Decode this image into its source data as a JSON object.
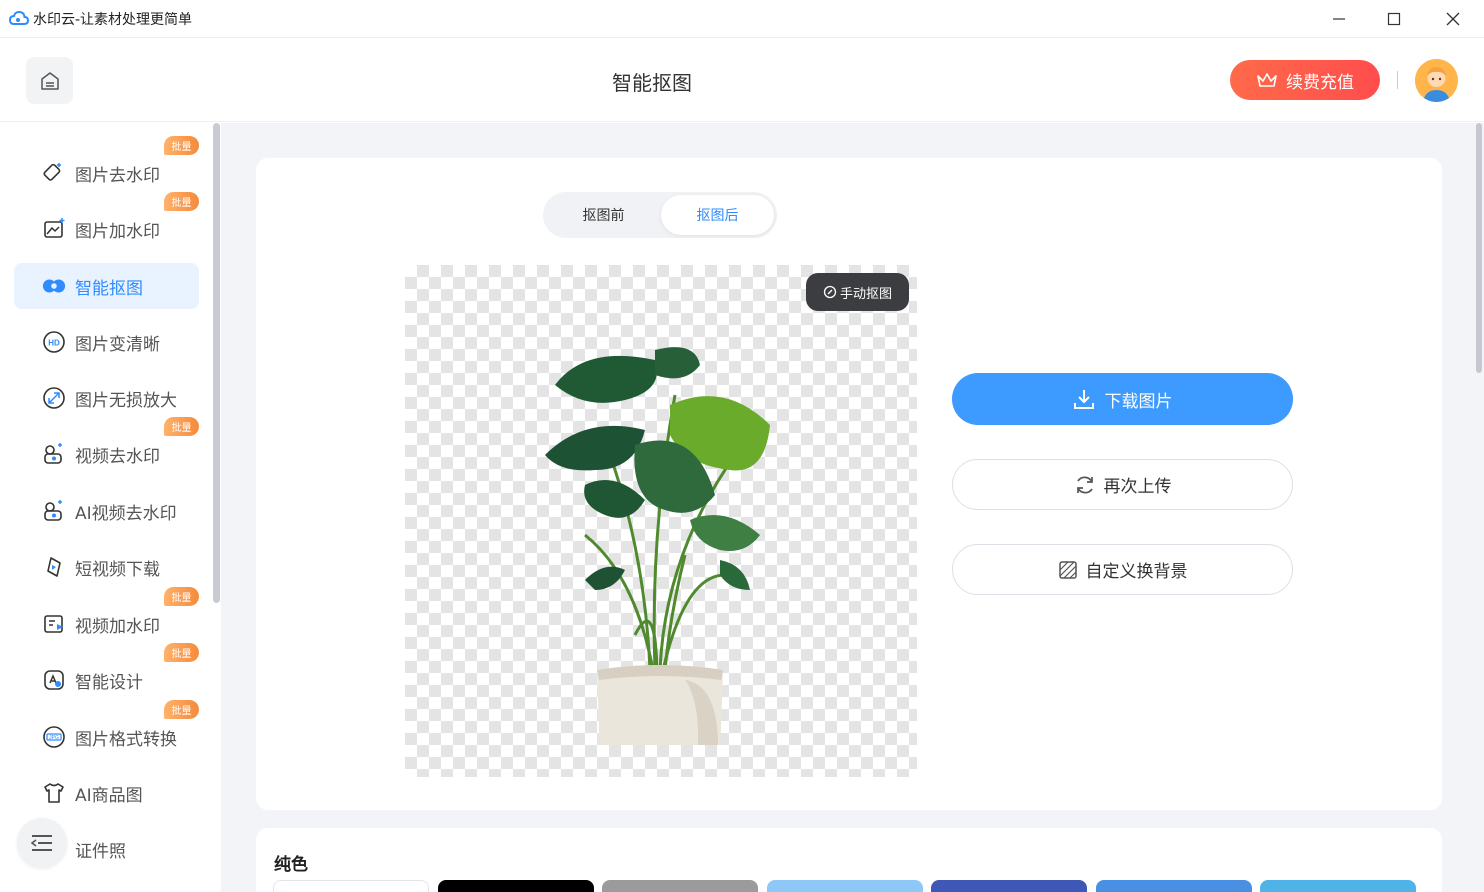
{
  "window": {
    "title": "水印云-让素材处理更简单"
  },
  "header": {
    "title": "智能抠图",
    "renew_label": "续费充值"
  },
  "sidebar": {
    "badge_label": "批量",
    "items": [
      {
        "label": "图片去水印",
        "badge": true,
        "active": false,
        "icon": "eraser-icon"
      },
      {
        "label": "图片加水印",
        "badge": true,
        "active": false,
        "icon": "image-add-icon"
      },
      {
        "label": "智能抠图",
        "badge": false,
        "active": true,
        "icon": "cutout-icon"
      },
      {
        "label": "图片变清晰",
        "badge": false,
        "active": false,
        "icon": "hd-icon"
      },
      {
        "label": "图片无损放大",
        "badge": false,
        "active": false,
        "icon": "enlarge-icon"
      },
      {
        "label": "视频去水印",
        "badge": true,
        "active": false,
        "icon": "video-eraser-icon"
      },
      {
        "label": "AI视频去水印",
        "badge": false,
        "active": false,
        "icon": "ai-video-icon"
      },
      {
        "label": "短视频下载",
        "badge": false,
        "active": false,
        "icon": "download-video-icon"
      },
      {
        "label": "视频加水印",
        "badge": true,
        "active": false,
        "icon": "video-add-icon"
      },
      {
        "label": "智能设计",
        "badge": true,
        "active": false,
        "icon": "design-icon"
      },
      {
        "label": "图片格式转换",
        "badge": true,
        "active": false,
        "icon": "jpg-convert-icon"
      },
      {
        "label": "AI商品图",
        "badge": false,
        "active": false,
        "icon": "tshirt-icon"
      },
      {
        "label": "证件照",
        "badge": false,
        "active": false,
        "icon": "id-photo-icon"
      }
    ]
  },
  "main": {
    "tabs": [
      {
        "label": "抠图前",
        "active": false
      },
      {
        "label": "抠图后",
        "active": true
      }
    ],
    "manual_label": "手动抠图",
    "download_label": "下载图片",
    "reupload_label": "再次上传",
    "custom_bg_label": "自定义换背景",
    "solid_title": "纯色",
    "swatches": [
      "#ffffff",
      "#000000",
      "#9b9b9b",
      "#8ec8f6",
      "#3f57b5",
      "#4a90e2",
      "#4fb3e8"
    ]
  },
  "colors": {
    "accent": "#3d9bff",
    "renew": "#ff5a4a",
    "badge": "#f58a3c"
  }
}
